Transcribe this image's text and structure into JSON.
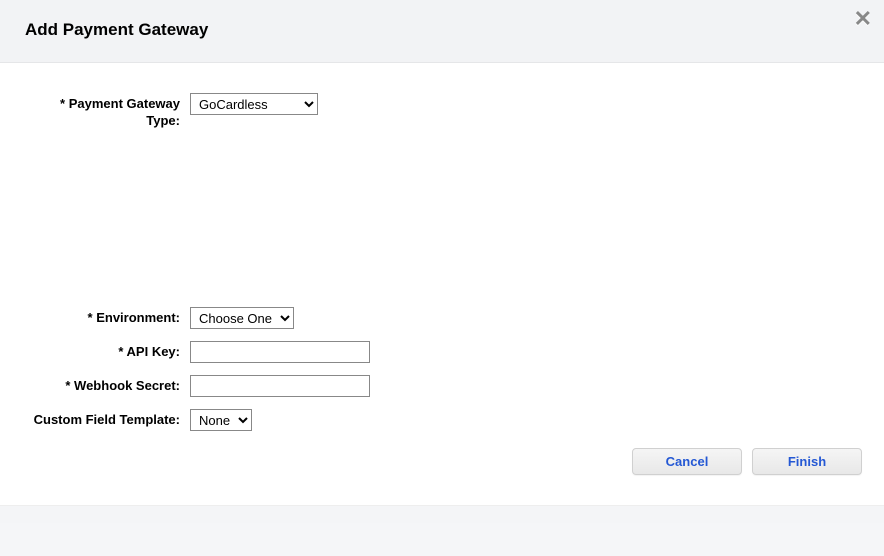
{
  "header": {
    "title": "Add Payment Gateway",
    "close_glyph": "✕"
  },
  "form": {
    "gateway": {
      "label": "* Payment Gateway Type:",
      "value": "GoCardless"
    },
    "environment": {
      "label": "* Environment:",
      "value": "Choose One"
    },
    "apikey": {
      "label": "* API Key:",
      "value": ""
    },
    "webhook": {
      "label": "* Webhook Secret:",
      "value": ""
    },
    "template": {
      "label": "Custom Field Template:",
      "value": "None"
    }
  },
  "buttons": {
    "cancel": "Cancel",
    "finish": "Finish"
  }
}
